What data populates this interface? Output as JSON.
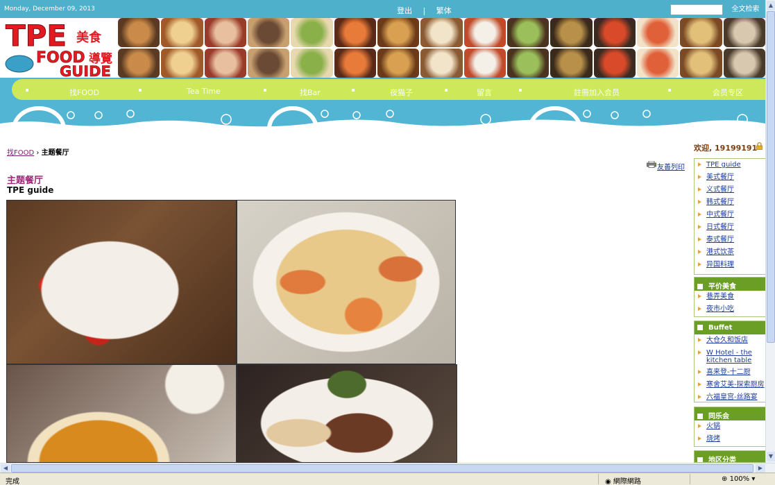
{
  "topbar": {
    "date": "Monday, December 09, 2013",
    "logout": "登出",
    "sep": "|",
    "traditional": "繁体",
    "search_placeholder": "",
    "search_button": "全文检索"
  },
  "logo": {
    "line1": "TPE",
    "line1b": "美食",
    "line2": "FOOD",
    "line2b": "導覽",
    "line3": "GUIDE"
  },
  "nav": {
    "items": [
      "找FOOD",
      "Tea Time",
      "找Bar",
      "夜猫子",
      "留言",
      "註冊加入会员",
      "会员专区"
    ]
  },
  "breadcrumb": {
    "link": "找FOOD",
    "arrow": "›",
    "current": "主题餐厅"
  },
  "print": {
    "label": "友善列印"
  },
  "page": {
    "title": "主题餐厅",
    "subtitle": "TPE guide"
  },
  "sidebar": {
    "welcome": "欢迎, 19199191",
    "groups": [
      {
        "title": "",
        "items": [
          "TPE guide",
          "美式餐厅",
          "义式餐厅",
          "韩式餐厅",
          "中式餐厅",
          "日式餐厅",
          "泰式餐厅",
          "港式饮茶",
          "异国料理"
        ]
      },
      {
        "title": "平价美食",
        "items": [
          "巷弄美食",
          "夜市小吃"
        ]
      },
      {
        "title": "Buffet",
        "items": [
          "大仓久和饭店",
          "W Hotel - the kitchen table",
          "喜来登-十二厨",
          "寒舍艾美-探索厨房",
          "六福皇宫-丝路宴"
        ]
      },
      {
        "title": "同乐会",
        "items": [
          "火锅",
          "烧烤"
        ]
      },
      {
        "title": "地区分类",
        "items": []
      }
    ]
  },
  "statusbar": {
    "done": "完成",
    "zone": "網際網路",
    "zoom": "100%"
  },
  "colors": {
    "topbar": "#4fb0cc",
    "nav": "#cde95a",
    "wave": "#51b5d3",
    "title": "#9b2a7a",
    "sidebar_head": "#6b9e25"
  }
}
